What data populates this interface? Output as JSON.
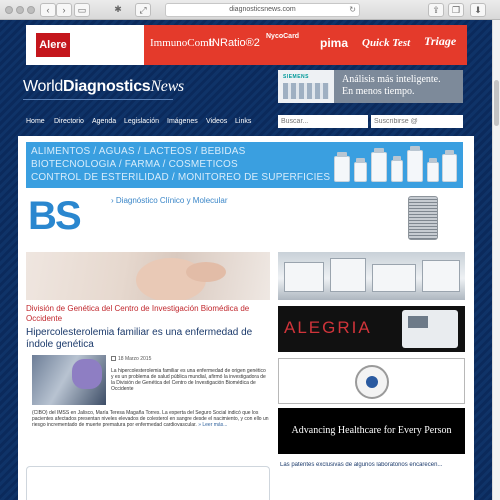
{
  "browser": {
    "url": "diagnosticsnews.com",
    "back_icon": "chevron-left-icon",
    "forward_icon": "chevron-right-icon",
    "sidebar_icon": "sidebar-icon",
    "share_icon": "share-icon",
    "tabs_icon": "tabs-icon",
    "reload_icon": "reload-icon"
  },
  "top_ad": {
    "logo": "Alere",
    "brands": [
      "ImmunoComb",
      "INRatio®2",
      "NycoCard",
      "pima",
      "Quick Test",
      "Triage"
    ]
  },
  "header": {
    "logo_part1": "World",
    "logo_part2": "Diagnostics",
    "logo_part3": "News",
    "siemens_logo": "SIEMENS",
    "siemens_line1": "Análisis más inteligente.",
    "siemens_line2": "En menos tiempo."
  },
  "nav": {
    "items": [
      "Home",
      "Directorio",
      "Agenda",
      "Legislación",
      "Imágenes",
      "Videos",
      "Links"
    ],
    "search_placeholder": "Buscar...",
    "subscribe_placeholder": "Suscribirse @"
  },
  "banner": {
    "line1": "ALIMENTOS / AGUAS / LACTEOS / BEBIDAS",
    "line2": "BIOTECNOLOGIA / FARMA / COSMETICOS",
    "line3": "CONTROL DE ESTERILIDAD / MONITOREO DE SUPERFICIES"
  },
  "bs": {
    "logo_b": "B",
    "logo_s": "S",
    "link": "› Diagnóstico Clínico y Molecular"
  },
  "article": {
    "kicker": "División de Genética del Centro de Investigación Biomédica de Occidente",
    "headline": "Hipercolesterolemia familiar es una enfermedad de índole genética",
    "date": "18 Marzo 2015",
    "body_top": "La hipercolesterolemia familiar es una enfermedad de origen genético y es un problema de salud pública mundial, afirmó la investigadora de la División de Genética del Centro de Investigación Biomédica de Occidente",
    "body_bottom": "(CIBO) del IMSS en Jalisco, María Teresa Magaña Torres. La experta del Seguro Social indicó que los pacientes afectados presentan niveles elevados de colesterol en sangre desde el nacimiento, y con ello un riesgo incrementado de muerte prematura por enfermedad cardiovascular.",
    "more": "» Leer más..."
  },
  "sidebar": {
    "alegria": "ALEGRIA",
    "advancing": "Advancing Healthcare for Every Person",
    "teaser": "Las patentes exclusivas de algunos laboratorios encarecen..."
  }
}
